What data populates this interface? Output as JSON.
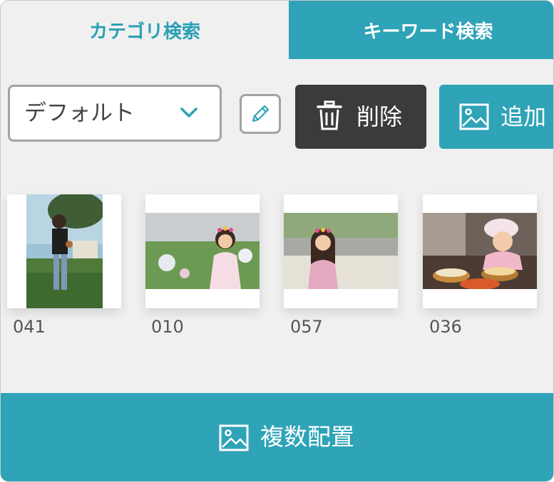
{
  "tabs": {
    "category_label": "カテゴリ検索",
    "keyword_label": "キーワード検索"
  },
  "toolbar": {
    "select_value": "デフォルト",
    "delete_label": "削除",
    "add_label": "追加"
  },
  "thumbnails": [
    {
      "label": "041",
      "orientation": "portrait"
    },
    {
      "label": "010",
      "orientation": "landscape"
    },
    {
      "label": "057",
      "orientation": "landscape"
    },
    {
      "label": "036",
      "orientation": "landscape"
    }
  ],
  "bottom": {
    "multi_place_label": "複数配置"
  },
  "colors": {
    "accent": "#2fa3b7",
    "dark_button": "#3b3b3b",
    "background": "#f0f0f0"
  },
  "icons": [
    "chevron-down-icon",
    "pencil-icon",
    "trash-icon",
    "image-icon"
  ]
}
